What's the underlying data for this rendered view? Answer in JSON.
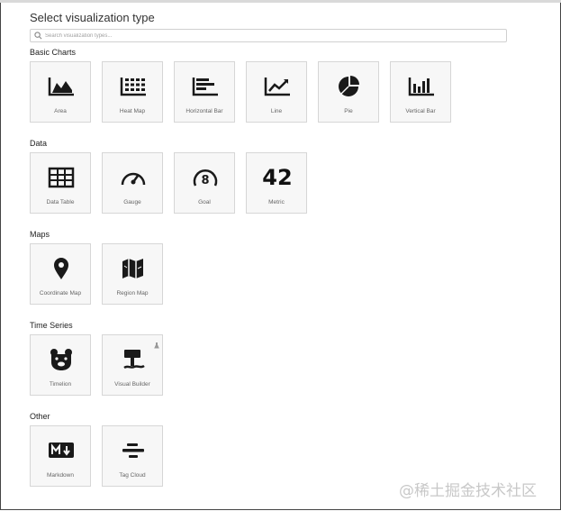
{
  "title": "Select visualization type",
  "search": {
    "placeholder": "Search visualization types..."
  },
  "sections": {
    "basic_charts": {
      "label": "Basic Charts",
      "items": [
        {
          "label": "Area",
          "icon": "area-chart-icon"
        },
        {
          "label": "Heat Map",
          "icon": "heat-map-icon"
        },
        {
          "label": "Horizontal Bar",
          "icon": "horizontal-bar-icon"
        },
        {
          "label": "Line",
          "icon": "line-chart-icon"
        },
        {
          "label": "Pie",
          "icon": "pie-chart-icon"
        },
        {
          "label": "Vertical Bar",
          "icon": "vertical-bar-icon"
        }
      ]
    },
    "data": {
      "label": "Data",
      "items": [
        {
          "label": "Data Table",
          "icon": "table-icon"
        },
        {
          "label": "Gauge",
          "icon": "gauge-icon"
        },
        {
          "label": "Goal",
          "icon": "goal-icon",
          "glyph": "8"
        },
        {
          "label": "Metric",
          "icon": "metric-icon",
          "glyph": "42"
        }
      ]
    },
    "maps": {
      "label": "Maps",
      "items": [
        {
          "label": "Coordinate Map",
          "icon": "map-pin-icon"
        },
        {
          "label": "Region Map",
          "icon": "region-map-icon"
        }
      ]
    },
    "time_series": {
      "label": "Time Series",
      "items": [
        {
          "label": "Timelion",
          "icon": "timelion-bear-icon"
        },
        {
          "label": "Visual Builder",
          "icon": "visual-builder-icon",
          "badge": "beta-flask-icon"
        }
      ]
    },
    "other": {
      "label": "Other",
      "items": [
        {
          "label": "Markdown",
          "icon": "markdown-icon"
        },
        {
          "label": "Tag Cloud",
          "icon": "tag-cloud-icon"
        }
      ]
    }
  },
  "watermark": "@稀土掘金技术社区",
  "colors": {
    "icon": "#1a1a1a",
    "tile_bg": "#f7f7f7",
    "tile_border": "#d6d6d6",
    "label": "#666666"
  }
}
